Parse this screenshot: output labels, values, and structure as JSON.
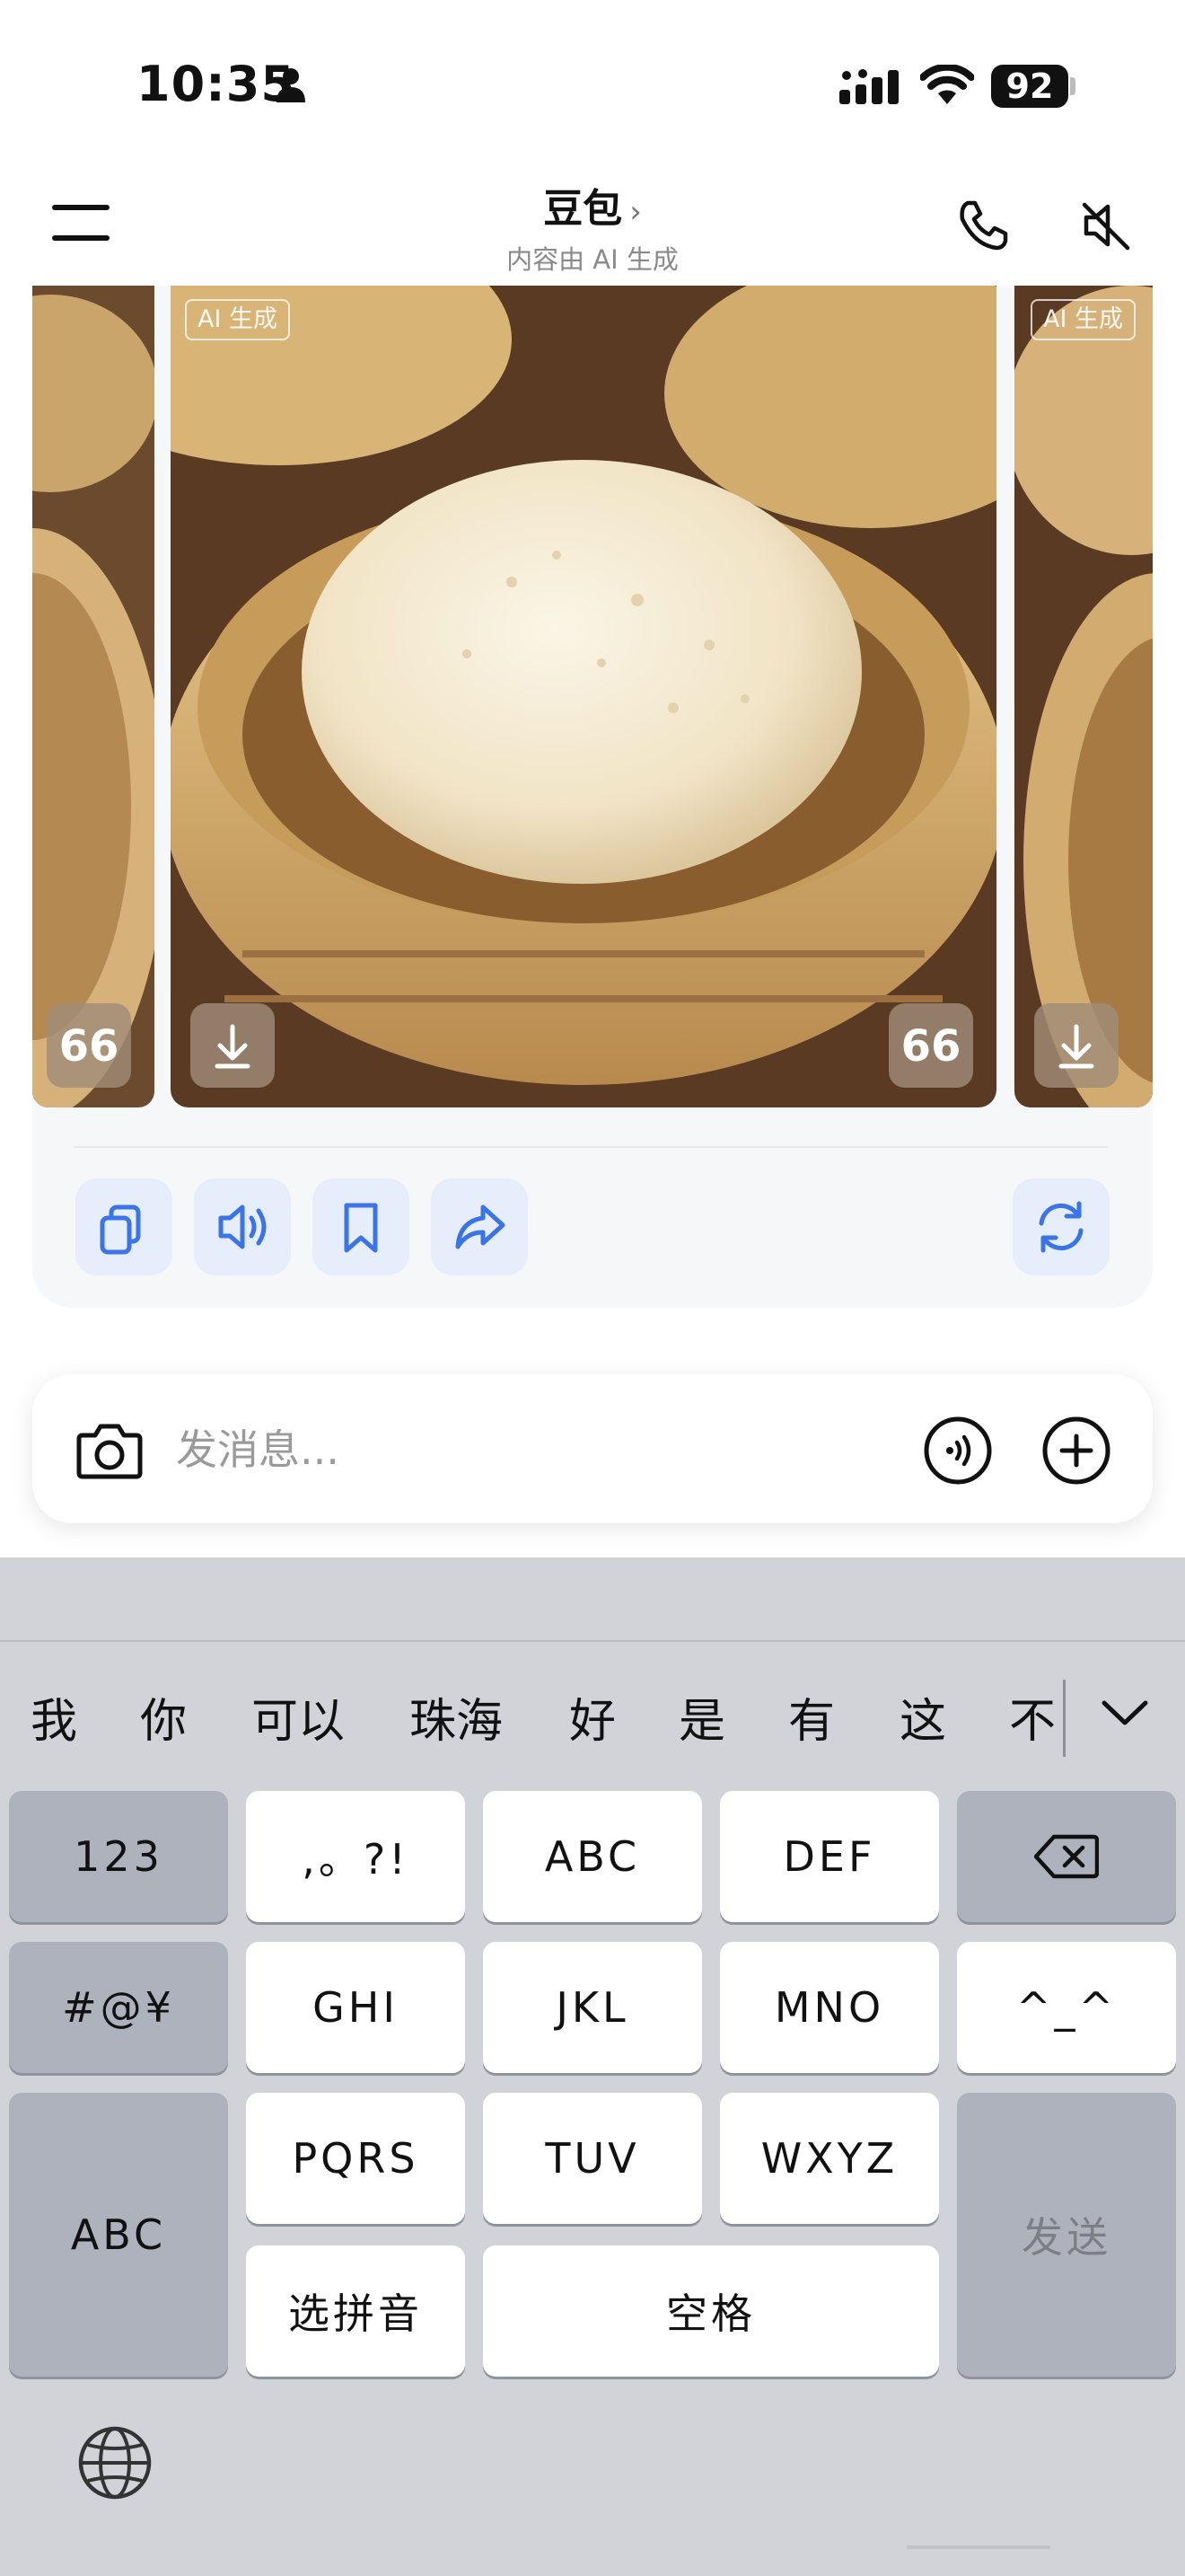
{
  "status_bar": {
    "time": "10:35",
    "battery": "92"
  },
  "header": {
    "title": "豆包",
    "chevron": "›",
    "subtitle": "内容由 AI 生成"
  },
  "images": {
    "badge_left": "AI 生成",
    "badge_right": "AI 生成"
  },
  "composer": {
    "placeholder": "发消息..."
  },
  "keyboard": {
    "candidates": [
      "我",
      "你",
      "可以",
      "珠海",
      "好",
      "是",
      "有",
      "这",
      "不"
    ],
    "keys": {
      "num": "123",
      "punct": ",。?!",
      "abc_key": "ABC",
      "def": "DEF",
      "symbols": "#@¥",
      "ghi": "GHI",
      "jkl": "JKL",
      "mno": "MNO",
      "emoticon": "^_^",
      "abc_switch": "ABC",
      "pqrs": "PQRS",
      "tuv": "TUV",
      "wxyz": "WXYZ",
      "send": "发送",
      "pinyin": "选拼音",
      "space": "空格"
    }
  },
  "icons": {
    "status": [
      "person-icon",
      "signal-icon",
      "wifi-icon"
    ],
    "header": [
      "menu-icon",
      "phone-icon",
      "mute-icon"
    ],
    "actions": [
      "copy-icon",
      "speaker-icon",
      "bookmark-icon",
      "share-icon",
      "regenerate-icon"
    ]
  },
  "colors": {
    "accent_blue": "#3b73e8",
    "action_bg": "#e7eefb",
    "keyboard_bg": "#d1d3d9"
  }
}
